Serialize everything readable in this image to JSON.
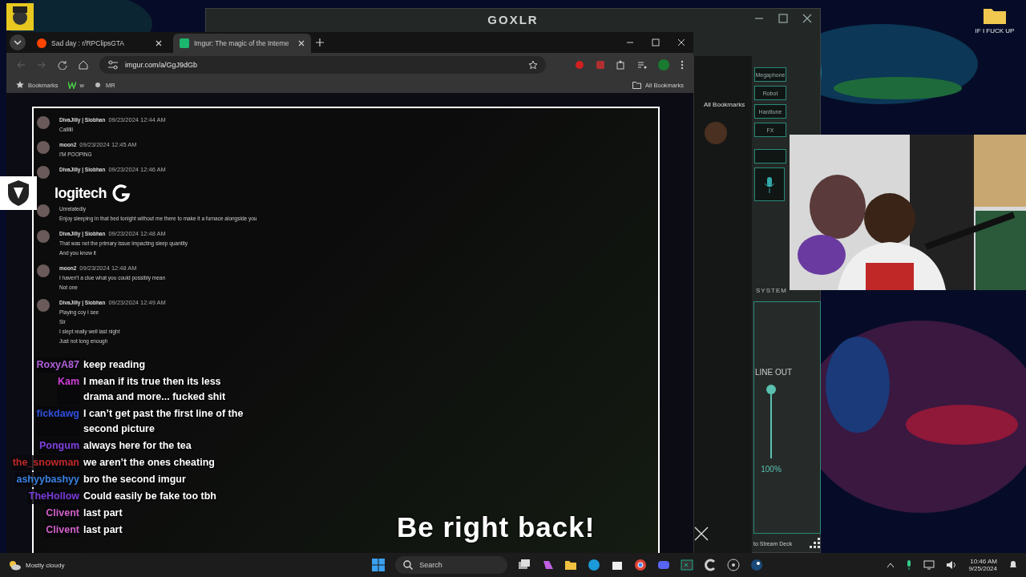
{
  "desktop": {
    "icons": [
      {
        "label": "IF I FUCK UP"
      }
    ]
  },
  "goxlr": {
    "title": "GOXLR",
    "effects": [
      "Megaphone",
      "Robot",
      "Hardtune",
      "FX"
    ],
    "section": "SYSTEM",
    "channel": {
      "name": "LINE OUT",
      "level": 1,
      "reading": "100%"
    },
    "footer": "to Stream Deck"
  },
  "back_browser": {
    "all_bookmarks": "All Bookmarks"
  },
  "browser": {
    "tabs": [
      {
        "title": "Sad day : r/RPClipsGTA",
        "selected": false
      },
      {
        "title": "Imgur: The magic of the Interne",
        "selected": true
      }
    ],
    "url": "imgur.com/a/GgJ9dGb",
    "bookmarks": [
      "Bookmarks",
      "w",
      "MR"
    ],
    "all_bookmarks": "All Bookmarks",
    "messages": [
      {
        "author": "DivaJilly | Siobhan",
        "time": "09/23/2024 12:44 AM",
        "lines": [
          "Callllll"
        ]
      },
      {
        "author": "moon2",
        "time": "09/23/2024 12:45 AM",
        "lines": [
          "I'M POOPING"
        ]
      },
      {
        "author": "DivaJilly | Siobhan",
        "time": "09/23/2024 12:46 AM"
      },
      {
        "lines": [
          "Unrelatedly",
          "Enjoy sleeping in that bed tonight without me there to make it a furnace alongside you"
        ]
      },
      {
        "author": "DivaJilly | Siobhan",
        "time": "09/23/2024 12:48 AM",
        "lines": [
          "That was not the primary issue impacting sleep quantity",
          "And you know it"
        ]
      },
      {
        "author": "moon2",
        "time": "09/23/2024 12:48 AM",
        "lines": [
          "I haven't a clue what you could possibly mean",
          "Not one"
        ]
      },
      {
        "author": "DivaJilly | Siobhan",
        "time": "09/23/2024 12:49 AM",
        "lines": [
          "Playing coy I see",
          "Sir",
          "I slept really well last night",
          "Just not long enough"
        ]
      }
    ]
  },
  "overlay": {
    "sponsor": "logitech",
    "banner": "Be right back!",
    "chat": [
      {
        "user": "RoxyA87",
        "color": "#b060d8",
        "text": "keep reading"
      },
      {
        "user": "Kam",
        "color": "#d040d8",
        "text": "I mean if its true then its less drama and more... fucked shit"
      },
      {
        "user": "fickdawg",
        "color": "#3050e0",
        "text": "I can’t get past the first line of the second picture"
      },
      {
        "user": "Pongum",
        "color": "#8040e0",
        "text": "always here for the tea"
      },
      {
        "user": "the_snowman",
        "color": "#c02828",
        "text": "we aren’t the ones cheating"
      },
      {
        "user": "ashyybashyy",
        "color": "#3a80e0",
        "text": "bro the second imgur"
      },
      {
        "user": "TheHollow",
        "color": "#7a3ad8",
        "text": "Could easily be fake too tbh"
      },
      {
        "user": "Clivent",
        "color": "#d060c8",
        "text": "last part"
      },
      {
        "user": "Clivent",
        "color": "#d060c8",
        "text": "last part"
      }
    ]
  },
  "taskbar": {
    "weather": "Mostly cloudy",
    "search": "Search",
    "time": "10:46 AM",
    "date": "9/25/2024"
  }
}
